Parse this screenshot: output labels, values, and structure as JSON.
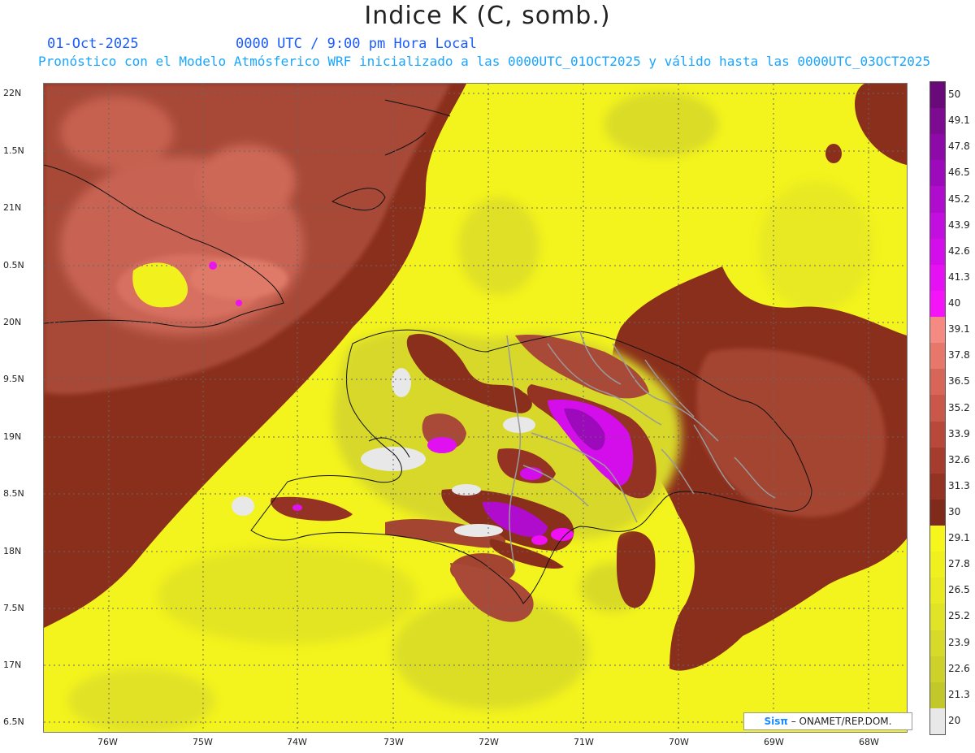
{
  "title": "Indice K (C, somb.)",
  "date_text": "01-Oct-2025",
  "time_text": "0000 UTC / 9:00 pm Hora Local",
  "forecast_text": "Pronóstico con el Modelo Atmósferico WRF inicializado a las 0000UTC_01OCT2025 y válido hasta las  0000UTC_03OCT2025",
  "credit": {
    "brand": "Sisπ",
    "org": " – ONAMET/REP.DOM."
  },
  "map": {
    "lon_labels": [
      "76W",
      "75W",
      "74W",
      "73W",
      "72W",
      "71W",
      "70W",
      "69W",
      "68W"
    ],
    "lat_labels": [
      "22N",
      "1.5N",
      "21N",
      "0.5N",
      "20N",
      "9.5N",
      "19N",
      "8.5N",
      "18N",
      "7.5N",
      "17N",
      "6.5N"
    ]
  },
  "colorbar": {
    "labels": [
      "50",
      "49.1",
      "47.8",
      "46.5",
      "45.2",
      "43.9",
      "42.6",
      "41.3",
      "40",
      "39.1",
      "37.8",
      "36.5",
      "35.2",
      "33.9",
      "32.6",
      "31.3",
      "30",
      "29.1",
      "27.8",
      "26.5",
      "25.2",
      "23.9",
      "22.6",
      "21.3",
      "20"
    ],
    "colors": [
      "#6a0a7a",
      "#7d0b92",
      "#8e0aa8",
      "#9c0abc",
      "#b00cce",
      "#c20ede",
      "#d40eea",
      "#e610f4",
      "#f514f8",
      "#f48a82",
      "#e8776b",
      "#d76658",
      "#c9584a",
      "#b8493a",
      "#a53c2e",
      "#943323",
      "#7f2a1a",
      "#f6f61c",
      "#f0f01e",
      "#e9ea22",
      "#e1e326",
      "#d7da28",
      "#cdd12a",
      "#c3c82a",
      "#e8e8e8"
    ]
  }
}
